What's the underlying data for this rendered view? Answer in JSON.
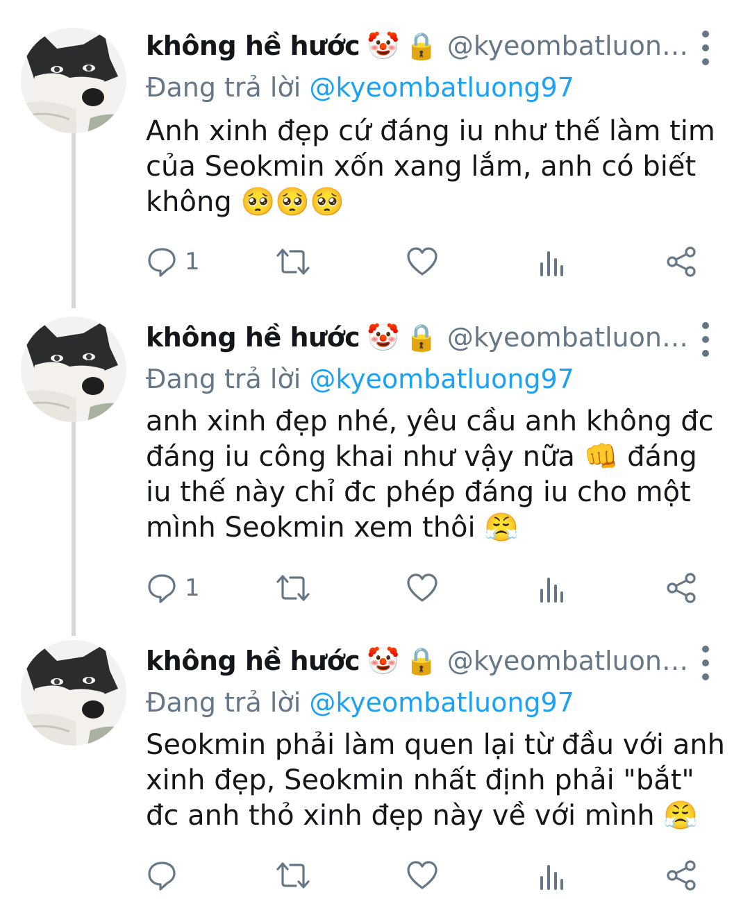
{
  "tweets": [
    {
      "name": "không hề hước",
      "handle": "@kyeombatluon…",
      "reply_prefix": "Đang trả lời ",
      "reply_to": "@kyeombatluong97",
      "text": "Anh xinh đẹp cứ đáng iu như thế làm tim của Seokmin xốn xang lắm, anh có biết không 🥺🥺🥺",
      "reply_count": "1"
    },
    {
      "name": "không hề hước",
      "handle": "@kyeombatluon…",
      "reply_prefix": "Đang trả lời ",
      "reply_to": "@kyeombatluong97",
      "text": "anh xinh đẹp nhé, yêu cầu anh không đc đáng iu công khai như vậy nữa 👊 đáng iu thế này chỉ đc phép đáng iu cho một mình Seokmin xem thôi 😤",
      "reply_count": "1"
    },
    {
      "name": "không hề hước",
      "handle": "@kyeombatluon…",
      "reply_prefix": "Đang trả lời ",
      "reply_to": "@kyeombatluong97",
      "text": "Seokmin phải làm quen lại từ đầu với anh xinh đẹp, Seokmin nhất định phải \"bắt\" đc anh thỏ xinh đẹp này về với mình 😤",
      "reply_count": ""
    }
  ],
  "icons": {
    "reply": "reply-icon",
    "retweet": "retweet-icon",
    "like": "heart-icon",
    "analytics": "analytics-icon",
    "share": "share-icon",
    "more": "more-vertical-icon"
  },
  "badges": {
    "clown": "🤡",
    "lock": "🔒"
  },
  "colors": {
    "link": "#1da1f2",
    "secondary": "#657786",
    "thread_line": "#d5d9dc"
  }
}
